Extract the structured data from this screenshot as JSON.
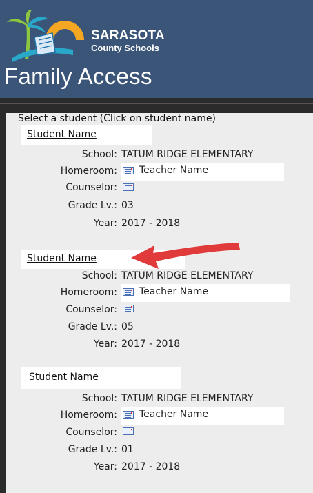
{
  "header": {
    "brand_line1": "SARASOTA",
    "brand_line2": "County Schools",
    "app_title": "Family Access"
  },
  "select_label": "Select a student (Click on student name)",
  "labels": {
    "school": "School:",
    "homeroom": "Homeroom:",
    "counselor": "Counselor:",
    "grade": "Grade Lv.:",
    "year": "Year:"
  },
  "students": [
    {
      "name": "Student Name",
      "school": "TATUM RIDGE ELEMENTARY",
      "homeroom": "Teacher Name",
      "counselor": "",
      "grade": "03",
      "year": "2017 - 2018"
    },
    {
      "name": "Student Name",
      "school": "TATUM RIDGE ELEMENTARY",
      "homeroom": "Teacher Name",
      "counselor": "",
      "grade": "05",
      "year": "2017 - 2018"
    },
    {
      "name": "Student Name",
      "school": "TATUM RIDGE ELEMENTARY",
      "homeroom": "Teacher Name",
      "counselor": "",
      "grade": "01",
      "year": "2017 - 2018"
    }
  ],
  "colors": {
    "header_bg": "#3a5577",
    "arrow": "#e03a3a"
  }
}
